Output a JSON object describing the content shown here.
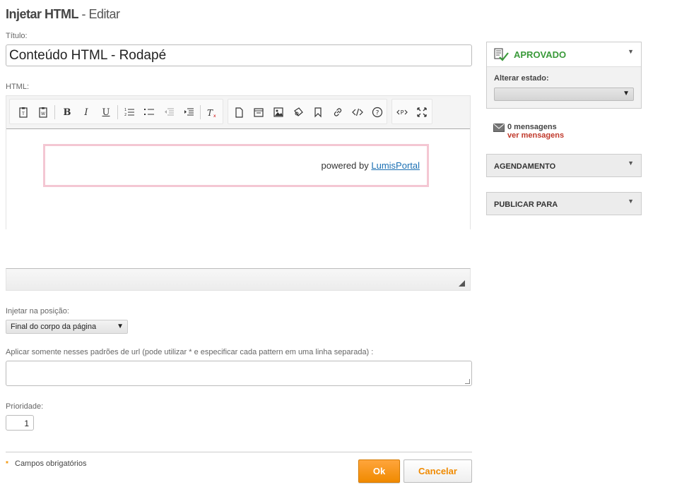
{
  "page": {
    "title": "Injetar HTML",
    "subtitle": "- Editar"
  },
  "form": {
    "title_label": "Título:",
    "title_value": "Conteúdo HTML - Rodapé",
    "html_label": "HTML:",
    "editor_content": {
      "powered_text": "powered by",
      "powered_link": "LumisPortal"
    },
    "position_label": "Injetar na posição:",
    "position_selected": "Final do corpo da página",
    "url_label": "Aplicar somente nesses padrões de url (pode utilizar * e especificar cada pattern em uma linha separada) :",
    "url_value": "",
    "priority_label": "Prioridade:",
    "priority_value": "1",
    "required_marker": "*",
    "required_text": "Campos obrigatórios",
    "ok_label": "Ok",
    "cancel_label": "Cancelar"
  },
  "toolbar": {
    "icons": [
      "paste-text-icon",
      "paste-word-icon",
      "bold-icon",
      "italic-icon",
      "underline-icon",
      "numbered-list-icon",
      "bulleted-list-icon",
      "decrease-indent-icon",
      "increase-indent-icon",
      "remove-format-icon",
      "new-page-icon",
      "templates-icon",
      "image-icon",
      "anchor-icon",
      "bookmark-icon",
      "link-icon",
      "source-code-icon",
      "help-icon",
      "embed-icon",
      "maximize-icon"
    ]
  },
  "sidebar": {
    "status": {
      "title": "APROVADO",
      "alter_label": "Alterar estado:",
      "color": "#3a9a3a"
    },
    "messages": {
      "count_text": "0 mensagens",
      "link_text": "ver mensagens"
    },
    "panels": [
      {
        "title": "AGENDAMENTO"
      },
      {
        "title": "PUBLICAR PARA"
      }
    ]
  },
  "colors": {
    "accent": "#f08a00",
    "link": "#1a6fb3",
    "message_link": "#c0392b"
  }
}
